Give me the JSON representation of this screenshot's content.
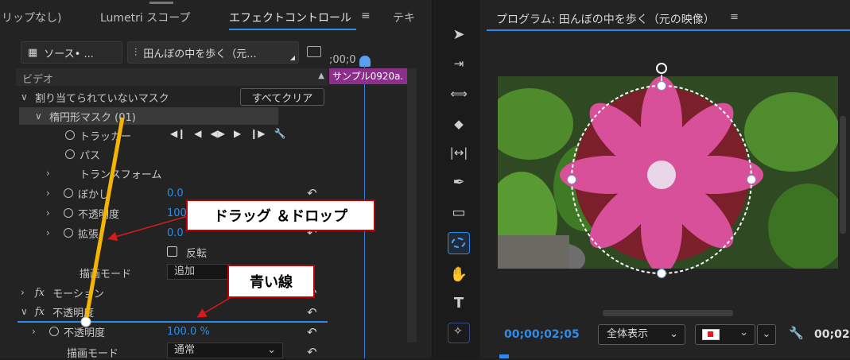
{
  "left_tabs": {
    "clip_none": "リップなし)",
    "lumetri": "Lumetri スコープ",
    "effect_controls": "エフェクトコントロール",
    "more": "テキ"
  },
  "source_tab": {
    "label": "ソース• ...",
    "sequence": "田んぼの中を歩く（元..."
  },
  "timeline": {
    "timecode": ";00;0",
    "clip_name": "サンプル0920a."
  },
  "video_header": "ビデオ",
  "mask_group": {
    "label": "割り当てられていないマスク",
    "clear_all": "すべてクリア"
  },
  "ellipse_mask": {
    "label": "楕円形マスク (01)",
    "tracker": "トラッカー",
    "path": "パス",
    "transform": "トランスフォーム",
    "feather": {
      "label": "ぼかし",
      "value": "0.0"
    },
    "opacity": {
      "label": "不透明度",
      "value": "100"
    },
    "expansion": {
      "label": "拡張",
      "value": "0.0"
    },
    "inverted": "反転",
    "blend_mode": {
      "label": "描画モード",
      "value": "追加"
    }
  },
  "motion": "モーション",
  "opacity_group": {
    "label": "不透明度",
    "opacity": {
      "label": "不透明度",
      "value": "100.0 %"
    },
    "blend_mode": {
      "label": "描画モード",
      "value": "通常"
    }
  },
  "callouts": {
    "drag_drop": "ドラッグ ＆ドロップ",
    "blue_line": "青い線"
  },
  "program": {
    "title": "プログラム: 田んぼの中を歩く（元の映像）",
    "timecode": "00;00;02;05",
    "zoom": "全体表示",
    "timecode_right": "00;02"
  },
  "colors": {
    "accent_blue": "#2d8ceb",
    "clip_purple": "#8b2f8b",
    "arrow_yellow": "#f5b400",
    "callout_red": "#c00000"
  }
}
